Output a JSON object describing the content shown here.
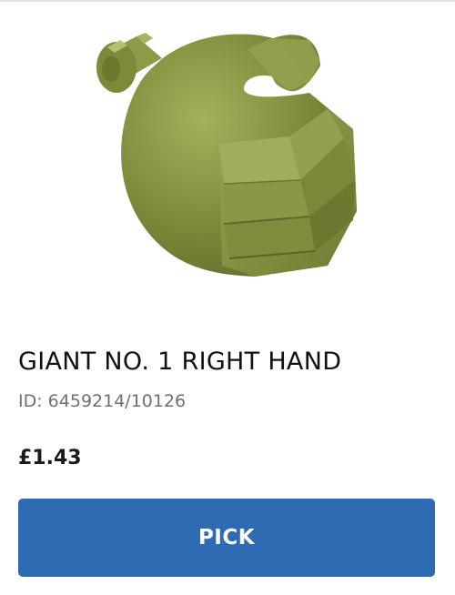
{
  "product": {
    "image_alt": "olive-green-giant-hand-brick",
    "title": "GIANT NO. 1 RIGHT HAND",
    "id_text": "ID: 6459214/10126",
    "price": "£1.43",
    "pick_label": "PICK",
    "colors": {
      "brick": "#7d8a3a",
      "button": "#2e6bb3"
    }
  }
}
